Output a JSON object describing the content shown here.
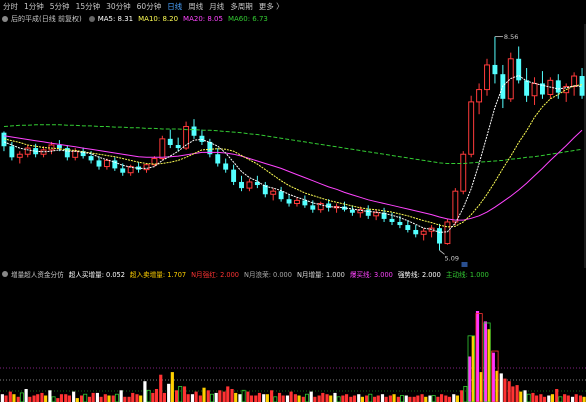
{
  "tabs": [
    {
      "label": "分时",
      "active": false
    },
    {
      "label": "1分钟",
      "active": false
    },
    {
      "label": "5分钟",
      "active": false
    },
    {
      "label": "15分钟",
      "active": false
    },
    {
      "label": "30分钟",
      "active": false
    },
    {
      "label": "60分钟",
      "active": false
    },
    {
      "label": "日线",
      "active": true
    },
    {
      "label": "周线",
      "active": false
    },
    {
      "label": "月线",
      "active": false
    },
    {
      "label": "多周期",
      "active": false
    },
    {
      "label": "更多 〉",
      "active": false
    }
  ],
  "main_info": {
    "title": "后的平成(日线 前复权)",
    "ma5": "MA5: 8.31",
    "ma10": "MA10: 8.20",
    "ma20": "MA20: 8.05",
    "ma60": "MA60: 6.73",
    "colors": {
      "ma5": "#ffffff",
      "ma10": "#ffff55",
      "ma20": "#ff44ff",
      "ma60": "#33cc33"
    }
  },
  "indicator_info": {
    "title": "增量超人资金分仿",
    "items": [
      {
        "text": "超人买增量: 0.052",
        "color": "#ffffff"
      },
      {
        "text": "超入卖增量: 1.707",
        "color": "#ffd000"
      },
      {
        "text": "N月强红: 2.000",
        "color": "#ff3333"
      },
      {
        "text": "N月浪荣: 0.000",
        "color": "#aaaaaa"
      },
      {
        "text": "N月增量: 1.000",
        "color": "#dddddd"
      },
      {
        "text": "爆买线: 3.000",
        "color": "#ff44ff"
      },
      {
        "text": "强势线: 2.000",
        "color": "#ffffff"
      },
      {
        "text": "主动线: 1.000",
        "color": "#33cc33"
      }
    ]
  },
  "price_labels": {
    "high": "8.56",
    "low": "5.09"
  },
  "chart_data": {
    "type": "candlestick",
    "price_range": [
      4.9,
      8.7
    ],
    "high_label": 8.56,
    "low_label": 5.09,
    "ohlc": [
      [
        7.0,
        7.02,
        6.7,
        6.78
      ],
      [
        6.78,
        6.85,
        6.55,
        6.6
      ],
      [
        6.6,
        6.7,
        6.5,
        6.65
      ],
      [
        6.65,
        6.8,
        6.6,
        6.75
      ],
      [
        6.75,
        6.82,
        6.6,
        6.65
      ],
      [
        6.65,
        6.78,
        6.6,
        6.72
      ],
      [
        6.72,
        6.85,
        6.65,
        6.8
      ],
      [
        6.8,
        6.88,
        6.7,
        6.75
      ],
      [
        6.75,
        6.8,
        6.55,
        6.6
      ],
      [
        6.6,
        6.75,
        6.55,
        6.7
      ],
      [
        6.7,
        6.76,
        6.58,
        6.62
      ],
      [
        6.62,
        6.7,
        6.5,
        6.55
      ],
      [
        6.55,
        6.62,
        6.4,
        6.45
      ],
      [
        6.45,
        6.58,
        6.4,
        6.55
      ],
      [
        6.55,
        6.6,
        6.38,
        6.42
      ],
      [
        6.42,
        6.5,
        6.3,
        6.35
      ],
      [
        6.35,
        6.48,
        6.3,
        6.45
      ],
      [
        6.45,
        6.52,
        6.35,
        6.4
      ],
      [
        6.4,
        6.5,
        6.35,
        6.48
      ],
      [
        6.48,
        6.62,
        6.45,
        6.58
      ],
      [
        6.58,
        6.95,
        6.55,
        6.9
      ],
      [
        6.9,
        7.05,
        6.75,
        6.8
      ],
      [
        6.8,
        6.92,
        6.7,
        6.75
      ],
      [
        6.75,
        7.18,
        6.72,
        7.1
      ],
      [
        7.1,
        7.22,
        6.9,
        6.95
      ],
      [
        6.95,
        7.05,
        6.8,
        6.85
      ],
      [
        6.85,
        6.9,
        6.6,
        6.65
      ],
      [
        6.65,
        6.75,
        6.45,
        6.5
      ],
      [
        6.5,
        6.58,
        6.35,
        6.4
      ],
      [
        6.4,
        6.48,
        6.15,
        6.2
      ],
      [
        6.2,
        6.3,
        6.05,
        6.1
      ],
      [
        6.1,
        6.25,
        6.05,
        6.2
      ],
      [
        6.2,
        6.3,
        6.1,
        6.15
      ],
      [
        6.15,
        6.2,
        5.95,
        6.0
      ],
      [
        6.0,
        6.1,
        5.9,
        6.05
      ],
      [
        6.05,
        6.12,
        5.88,
        5.92
      ],
      [
        5.92,
        6.0,
        5.8,
        5.85
      ],
      [
        5.85,
        5.95,
        5.8,
        5.9
      ],
      [
        5.9,
        5.98,
        5.78,
        5.82
      ],
      [
        5.82,
        5.9,
        5.7,
        5.75
      ],
      [
        5.75,
        5.88,
        5.7,
        5.85
      ],
      [
        5.85,
        5.92,
        5.72,
        5.78
      ],
      [
        5.78,
        5.85,
        5.7,
        5.8
      ],
      [
        5.8,
        5.88,
        5.72,
        5.75
      ],
      [
        5.75,
        5.82,
        5.65,
        5.7
      ],
      [
        5.7,
        5.8,
        5.62,
        5.75
      ],
      [
        5.75,
        5.82,
        5.6,
        5.65
      ],
      [
        5.65,
        5.75,
        5.58,
        5.7
      ],
      [
        5.7,
        5.78,
        5.55,
        5.6
      ],
      [
        5.6,
        5.7,
        5.5,
        5.55
      ],
      [
        5.55,
        5.65,
        5.45,
        5.5
      ],
      [
        5.5,
        5.58,
        5.38,
        5.42
      ],
      [
        5.42,
        5.5,
        5.3,
        5.35
      ],
      [
        5.35,
        5.45,
        5.25,
        5.4
      ],
      [
        5.4,
        5.5,
        5.3,
        5.45
      ],
      [
        5.45,
        5.52,
        5.09,
        5.2
      ],
      [
        5.2,
        5.6,
        5.18,
        5.55
      ],
      [
        5.55,
        6.1,
        5.5,
        6.05
      ],
      [
        6.05,
        6.7,
        6.0,
        6.65
      ],
      [
        6.65,
        7.6,
        6.6,
        7.5
      ],
      [
        7.5,
        7.8,
        7.3,
        7.7
      ],
      [
        7.7,
        8.2,
        7.6,
        8.1
      ],
      [
        8.1,
        8.56,
        7.8,
        7.95
      ],
      [
        7.95,
        8.1,
        7.4,
        7.55
      ],
      [
        7.55,
        8.3,
        7.5,
        8.2
      ],
      [
        8.2,
        8.4,
        7.8,
        7.85
      ],
      [
        7.85,
        8.05,
        7.5,
        7.6
      ],
      [
        7.6,
        7.9,
        7.45,
        7.8
      ],
      [
        7.8,
        8.0,
        7.55,
        7.62
      ],
      [
        7.62,
        7.9,
        7.55,
        7.85
      ],
      [
        7.85,
        7.95,
        7.55,
        7.65
      ],
      [
        7.65,
        7.8,
        7.5,
        7.75
      ],
      [
        7.75,
        7.98,
        7.6,
        7.92
      ],
      [
        7.92,
        8.05,
        7.55,
        7.6
      ]
    ],
    "ma5": [
      6.85,
      6.8,
      6.75,
      6.72,
      6.7,
      6.69,
      6.7,
      6.72,
      6.7,
      6.7,
      6.68,
      6.66,
      6.6,
      6.56,
      6.52,
      6.47,
      6.44,
      6.42,
      6.42,
      6.45,
      6.55,
      6.62,
      6.7,
      6.8,
      6.88,
      6.89,
      6.84,
      6.78,
      6.67,
      6.52,
      6.37,
      6.27,
      6.21,
      6.13,
      6.1,
      6.06,
      6.0,
      5.95,
      5.91,
      5.86,
      5.83,
      5.8,
      5.79,
      5.78,
      5.76,
      5.74,
      5.72,
      5.71,
      5.69,
      5.66,
      5.62,
      5.57,
      5.51,
      5.45,
      5.43,
      5.38,
      5.39,
      5.53,
      5.78,
      6.09,
      6.5,
      6.95,
      7.41,
      7.76,
      7.88,
      7.93,
      7.84,
      7.8,
      7.77,
      7.74,
      7.71,
      7.73,
      7.76,
      7.75
    ],
    "ma10": [
      6.9,
      6.87,
      6.84,
      6.8,
      6.78,
      6.76,
      6.75,
      6.74,
      6.72,
      6.71,
      6.69,
      6.67,
      6.65,
      6.63,
      6.61,
      6.58,
      6.55,
      6.52,
      6.5,
      6.49,
      6.5,
      6.52,
      6.55,
      6.6,
      6.66,
      6.72,
      6.73,
      6.74,
      6.73,
      6.7,
      6.63,
      6.56,
      6.49,
      6.4,
      6.31,
      6.22,
      6.14,
      6.08,
      6.02,
      5.98,
      5.94,
      5.9,
      5.87,
      5.84,
      5.81,
      5.78,
      5.76,
      5.75,
      5.73,
      5.71,
      5.68,
      5.65,
      5.61,
      5.57,
      5.54,
      5.5,
      5.47,
      5.48,
      5.55,
      5.67,
      5.82,
      6.0,
      6.2,
      6.42,
      6.62,
      6.84,
      7.03,
      7.25,
      7.42,
      7.55,
      7.62,
      7.7,
      7.76,
      7.78
    ],
    "ma20": [
      6.95,
      6.93,
      6.91,
      6.89,
      6.87,
      6.85,
      6.83,
      6.81,
      6.79,
      6.77,
      6.75,
      6.73,
      6.71,
      6.69,
      6.67,
      6.65,
      6.63,
      6.61,
      6.6,
      6.6,
      6.6,
      6.61,
      6.62,
      6.64,
      6.66,
      6.68,
      6.68,
      6.68,
      6.67,
      6.65,
      6.62,
      6.58,
      6.54,
      6.5,
      6.46,
      6.42,
      6.37,
      6.32,
      6.27,
      6.22,
      6.17,
      6.12,
      6.08,
      6.03,
      5.99,
      5.95,
      5.91,
      5.88,
      5.85,
      5.82,
      5.79,
      5.76,
      5.73,
      5.7,
      5.67,
      5.63,
      5.6,
      5.58,
      5.58,
      5.61,
      5.65,
      5.71,
      5.79,
      5.88,
      5.97,
      6.07,
      6.18,
      6.3,
      6.42,
      6.55,
      6.67,
      6.79,
      6.92,
      7.04
    ],
    "ma60": [
      7.1,
      7.11,
      7.12,
      7.12,
      7.13,
      7.13,
      7.13,
      7.13,
      7.12,
      7.12,
      7.11,
      7.11,
      7.1,
      7.1,
      7.09,
      7.09,
      7.08,
      7.08,
      7.07,
      7.07,
      7.06,
      7.06,
      7.06,
      7.05,
      7.05,
      7.04,
      7.04,
      7.03,
      7.02,
      7.01,
      7.0,
      6.98,
      6.97,
      6.95,
      6.93,
      6.91,
      6.89,
      6.87,
      6.85,
      6.83,
      6.81,
      6.79,
      6.77,
      6.75,
      6.73,
      6.71,
      6.69,
      6.67,
      6.65,
      6.63,
      6.61,
      6.59,
      6.57,
      6.55,
      6.53,
      6.51,
      6.5,
      6.5,
      6.5,
      6.51,
      6.52,
      6.53,
      6.54,
      6.55,
      6.57,
      6.58,
      6.6,
      6.61,
      6.63,
      6.65,
      6.67,
      6.69,
      6.71,
      6.73
    ],
    "volume_buy": [
      0.6,
      0.8,
      0.4,
      1.0,
      0.5,
      0.7,
      0.9,
      0.3,
      0.6,
      0.8,
      0.5,
      0.4,
      0.7,
      0.6,
      0.5,
      0.9,
      0.4,
      0.6,
      1.6,
      0.7,
      2.1,
      1.4,
      0.9,
      1.2,
      0.6,
      0.5,
      0.9,
      0.7,
      0.8,
      1.0,
      0.6,
      0.8,
      0.5,
      0.6,
      0.9,
      0.7,
      0.5,
      0.6,
      0.4,
      0.8,
      0.5,
      0.6,
      0.7,
      0.5,
      0.4,
      0.6,
      0.5,
      0.4,
      0.6,
      0.5,
      0.4,
      0.5,
      0.4,
      0.6,
      0.5,
      0.4,
      0.5,
      0.6,
      0.9,
      3.5,
      7.0,
      6.2,
      3.8,
      2.2,
      1.6,
      1.3,
      0.9,
      0.7,
      0.6,
      0.5,
      1.0,
      0.6,
      0.4,
      0.5
    ],
    "volume_sell": [
      0.5,
      0.6,
      0.7,
      0.4,
      0.6,
      0.5,
      0.4,
      0.6,
      0.5,
      0.3,
      0.6,
      0.7,
      0.4,
      0.5,
      0.6,
      0.4,
      0.7,
      0.5,
      0.9,
      1.0,
      0.7,
      2.3,
      1.2,
      0.6,
      0.8,
      1.1,
      0.6,
      0.9,
      1.2,
      0.7,
      0.9,
      0.5,
      0.7,
      0.6,
      0.4,
      0.5,
      0.8,
      0.5,
      0.6,
      0.4,
      0.7,
      0.5,
      0.4,
      0.6,
      0.5,
      0.4,
      0.6,
      0.5,
      0.4,
      0.6,
      0.5,
      0.4,
      0.5,
      0.4,
      0.5,
      0.6,
      0.4,
      0.5,
      1.2,
      5.1,
      2.3,
      5.6,
      2.4,
      1.8,
      1.2,
      0.8,
      0.6,
      0.5,
      0.4,
      0.6,
      0.4,
      0.5,
      0.6,
      0.4
    ],
    "volume_range": [
      0,
      9
    ]
  }
}
